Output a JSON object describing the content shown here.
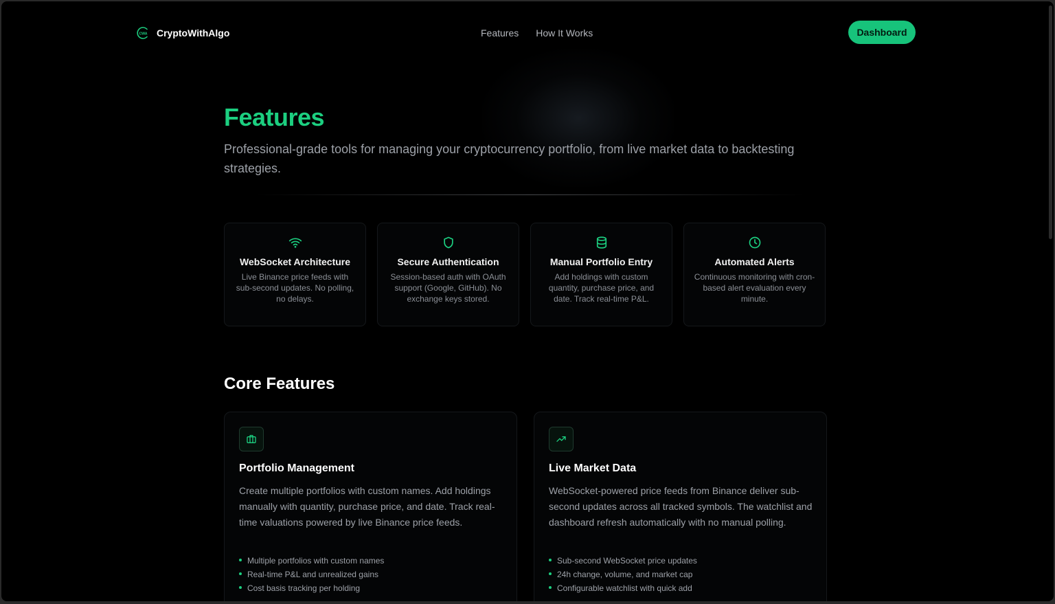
{
  "nav": {
    "logo_text": "CWA",
    "brand": "CryptoWithAlgo",
    "links": [
      "Features",
      "How It Works"
    ],
    "cta": "Dashboard"
  },
  "hero": {
    "title": "Features",
    "subtitle": "Professional-grade tools for managing your cryptocurrency portfolio, from live market data to backtesting strategies."
  },
  "highlights": [
    {
      "icon": "wifi-icon",
      "title": "WebSocket Architecture",
      "desc": "Live Binance price feeds with sub-second updates. No polling, no delays."
    },
    {
      "icon": "shield-icon",
      "title": "Secure Authentication",
      "desc": "Session-based auth with OAuth support (Google, GitHub). No exchange keys stored."
    },
    {
      "icon": "database-icon",
      "title": "Manual Portfolio Entry",
      "desc": "Add holdings with custom quantity, purchase price, and date. Track real-time P&L."
    },
    {
      "icon": "clock-icon",
      "title": "Automated Alerts",
      "desc": "Continuous monitoring with cron-based alert evaluation every minute."
    }
  ],
  "core": {
    "title": "Core Features",
    "items": [
      {
        "icon": "briefcase-icon",
        "title": "Portfolio Management",
        "desc": "Create multiple portfolios with custom names. Add holdings manually with quantity, purchase price, and date. Track real-time valuations powered by live Binance price feeds.",
        "bullets": [
          "Multiple portfolios with custom names",
          "Real-time P&L and unrealized gains",
          "Cost basis tracking per holding"
        ]
      },
      {
        "icon": "trending-up-icon",
        "title": "Live Market Data",
        "desc": "WebSocket-powered price feeds from Binance deliver sub-second updates across all tracked symbols. The watchlist and dashboard refresh automatically with no manual polling.",
        "bullets": [
          "Sub-second WebSocket price updates",
          "24h change, volume, and market cap",
          "Configurable watchlist with quick add"
        ]
      }
    ]
  },
  "colors": {
    "accent": "#1ccf80",
    "button": "#17c37b",
    "background": "#000000"
  }
}
